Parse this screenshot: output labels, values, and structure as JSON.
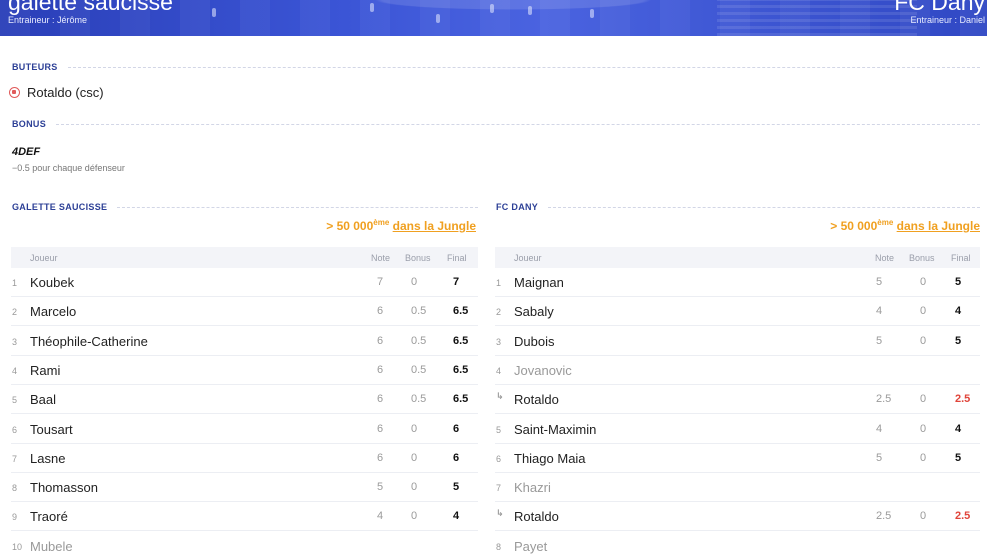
{
  "header": {
    "left_team": "galette saucisse",
    "left_coach": "Entraineur : Jérôme",
    "right_team": "FC Dany",
    "right_coach": "Entraineur : Daniel"
  },
  "buteurs": {
    "label": "BUTEURS",
    "scorer": "Rotaldo (csc)",
    "icon": "ball-icon"
  },
  "bonus": {
    "label": "BONUS",
    "name": "4DEF",
    "description": "−0.5 pour chaque défenseur"
  },
  "left": {
    "label": "GALETTE SAUCISSE",
    "rank_prefix": "> 50 000",
    "rank_sup": "ème",
    "rank_link": "dans la Jungle",
    "columns": {
      "player": "Joueur",
      "note": "Note",
      "bonus": "Bonus",
      "final": "Final"
    },
    "players": [
      {
        "num": "1",
        "name": "Koubek",
        "note": "7",
        "bonus": "0",
        "final": "7"
      },
      {
        "num": "2",
        "name": "Marcelo",
        "note": "6",
        "bonus": "0.5",
        "final": "6.5"
      },
      {
        "num": "3",
        "name": "Théophile-Catherine",
        "note": "6",
        "bonus": "0.5",
        "final": "6.5"
      },
      {
        "num": "4",
        "name": "Rami",
        "note": "6",
        "bonus": "0.5",
        "final": "6.5"
      },
      {
        "num": "5",
        "name": "Baal",
        "note": "6",
        "bonus": "0.5",
        "final": "6.5"
      },
      {
        "num": "6",
        "name": "Tousart",
        "note": "6",
        "bonus": "0",
        "final": "6"
      },
      {
        "num": "7",
        "name": "Lasne",
        "note": "6",
        "bonus": "0",
        "final": "6"
      },
      {
        "num": "8",
        "name": "Thomasson",
        "note": "5",
        "bonus": "0",
        "final": "5"
      },
      {
        "num": "9",
        "name": "Traoré",
        "note": "4",
        "bonus": "0",
        "final": "4"
      },
      {
        "num": "10",
        "name": "Mubele",
        "note": "",
        "bonus": "",
        "final": ""
      }
    ]
  },
  "right": {
    "label": "FC DANY",
    "rank_prefix": "> 50 000",
    "rank_sup": "ème",
    "rank_link": "dans la Jungle",
    "columns": {
      "player": "Joueur",
      "note": "Note",
      "bonus": "Bonus",
      "final": "Final"
    },
    "players": [
      {
        "num": "1",
        "name": "Maignan",
        "note": "5",
        "bonus": "0",
        "final": "5"
      },
      {
        "num": "2",
        "name": "Sabaly",
        "note": "4",
        "bonus": "0",
        "final": "4"
      },
      {
        "num": "3",
        "name": "Dubois",
        "note": "5",
        "bonus": "0",
        "final": "5"
      },
      {
        "num": "4",
        "name": "Jovanovic",
        "note": "",
        "bonus": "",
        "final": ""
      },
      {
        "num": "↳",
        "name": "Rotaldo",
        "note": "2.5",
        "bonus": "0",
        "final": "2.5"
      },
      {
        "num": "5",
        "name": "Saint-Maximin",
        "note": "4",
        "bonus": "0",
        "final": "4"
      },
      {
        "num": "6",
        "name": "Thiago Maia",
        "note": "5",
        "bonus": "0",
        "final": "5"
      },
      {
        "num": "7",
        "name": "Khazri",
        "note": "",
        "bonus": "",
        "final": ""
      },
      {
        "num": "↳",
        "name": "Rotaldo",
        "note": "2.5",
        "bonus": "0",
        "final": "2.5"
      },
      {
        "num": "8",
        "name": "Payet",
        "note": "",
        "bonus": "",
        "final": ""
      }
    ]
  },
  "colors": {
    "accent": "#2c3f96",
    "rank": "#f0a020",
    "penalty": "#e0443a",
    "substitute": "#2ea84a"
  }
}
